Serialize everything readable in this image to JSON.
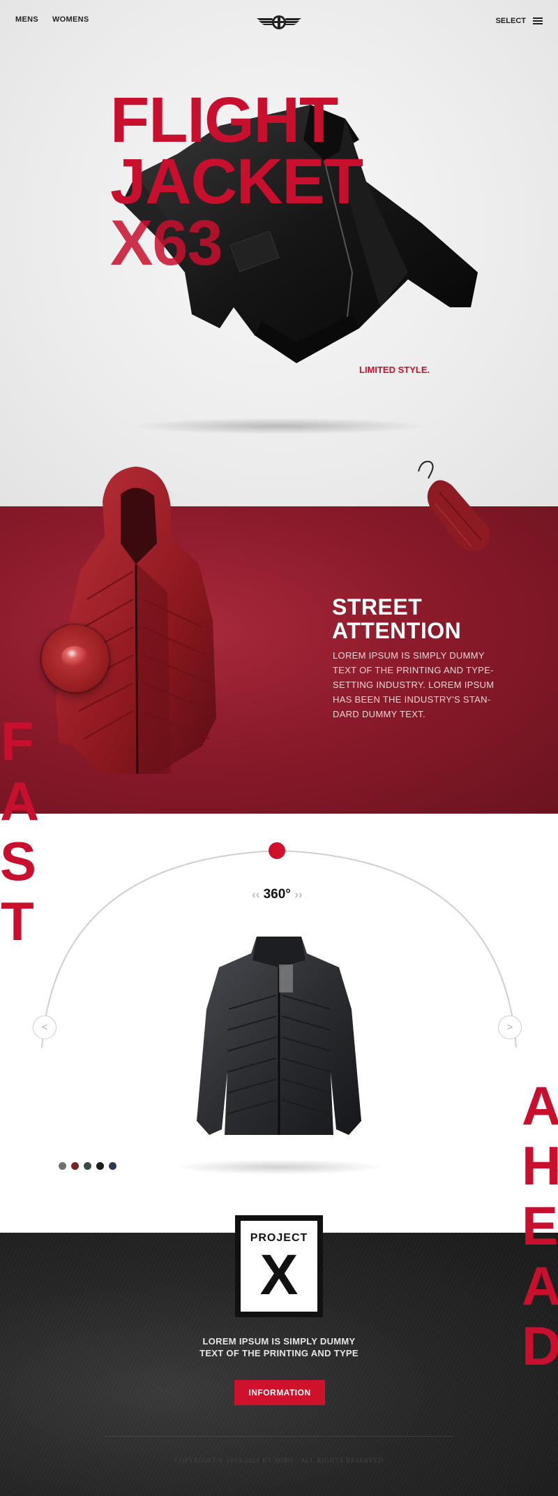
{
  "nav": {
    "mens": "MENS",
    "womens": "WOMENS",
    "select": "SELECT"
  },
  "hero": {
    "title_line1": "FLIGHT",
    "title_line2": "JACKET",
    "title_line3": "X63",
    "tagline": "LIMITED STYLE."
  },
  "feature": {
    "title_line1": "STREET",
    "title_line2": "ATTENTION",
    "body": "LOREM IPSUM IS SIMPLY DUMMY TEXT OF THE PRINTING AND TYPE-SETTING INDUSTRY. LOREM IPSUM HAS BEEN THE INDUSTRY'S STAN-DARD DUMMY TEXT."
  },
  "vertical_words": {
    "left": [
      "F",
      "A",
      "S",
      "T"
    ],
    "right": [
      "A",
      "H",
      "E",
      "A",
      "D"
    ]
  },
  "viewer": {
    "rotation_label": "360°",
    "chev_left": "‹‹",
    "chev_right": "››",
    "prev_label": "<",
    "next_label": ">",
    "swatches": [
      "#707070",
      "#7a2424",
      "#3b4a44",
      "#1c1c1c",
      "#2b3b4a"
    ]
  },
  "footer": {
    "badge_top": "PROJECT",
    "badge_letter": "X",
    "text_line1": "LOREM IPSUM IS SIMPLY DUMMY",
    "text_line2": "TEXT OF THE PRINTING AND TYPE",
    "button": "INFORMATION",
    "copyright": "COPYRIGHT © 2013-2014 BY MIRO · ALL RIGHTS RESERVED"
  },
  "colors": {
    "accent": "#c8102e",
    "feature_bg": "#8b1a2a",
    "footer_bg": "#262626"
  },
  "icons": [
    "wings-logo-icon",
    "hamburger-menu-icon",
    "chevron-left-icon",
    "chevron-right-icon"
  ]
}
